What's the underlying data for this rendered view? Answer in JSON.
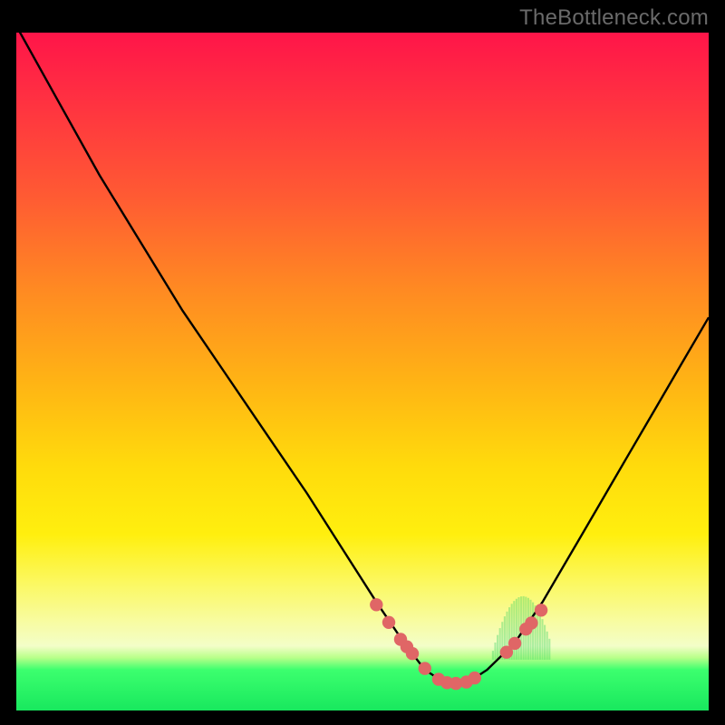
{
  "watermark": "TheBottleneck.com",
  "chart_data": {
    "type": "line",
    "title": "",
    "xlabel": "",
    "ylabel": "",
    "ylim": [
      0,
      100
    ],
    "xlim": [
      0,
      100
    ],
    "series": [
      {
        "name": "curve",
        "x": [
          0,
          6,
          12,
          18,
          24,
          30,
          36,
          42,
          47,
          52,
          56,
          59,
          62,
          65,
          68,
          72,
          76,
          80,
          84,
          88,
          92,
          96,
          100
        ],
        "y": [
          101,
          90,
          79,
          69,
          59,
          50,
          41,
          32,
          24,
          16,
          10,
          6,
          4,
          4,
          6,
          10,
          16,
          23,
          30,
          37,
          44,
          51,
          58
        ]
      }
    ],
    "markers": {
      "name": "dots",
      "color": "#e06666",
      "x": [
        52.0,
        53.8,
        55.5,
        56.4,
        57.2,
        59.0,
        61.0,
        62.2,
        63.5,
        65.0,
        66.2,
        70.8,
        72.0,
        73.6,
        74.4,
        75.8
      ],
      "y": [
        15.6,
        13.0,
        10.5,
        9.4,
        8.4,
        6.2,
        4.6,
        4.1,
        4.0,
        4.2,
        4.8,
        8.6,
        9.9,
        12.0,
        12.9,
        14.8
      ]
    },
    "hatch_band": {
      "x_start": 68.5,
      "x_end": 77.0,
      "y_base_pct": 92.5
    }
  }
}
